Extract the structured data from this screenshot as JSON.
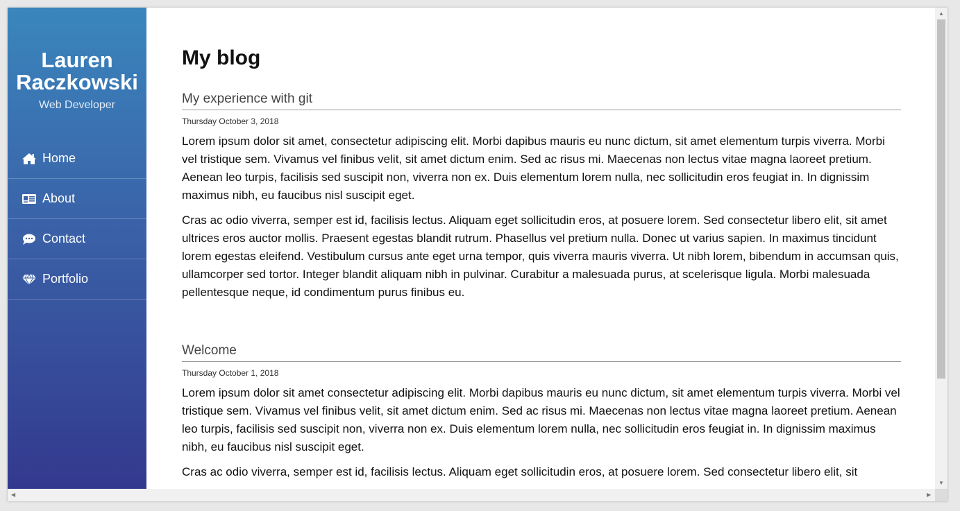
{
  "brand": {
    "name": "Lauren Raczkowski",
    "subtitle": "Web Developer"
  },
  "nav": [
    {
      "label": "Home",
      "icon": "home-icon"
    },
    {
      "label": "About",
      "icon": "id-card-icon"
    },
    {
      "label": "Contact",
      "icon": "chat-bubble-icon"
    },
    {
      "label": "Portfolio",
      "icon": "diamond-icon"
    }
  ],
  "page": {
    "title": "My blog"
  },
  "posts": [
    {
      "title": "My experience with git",
      "date": "Thursday October 3, 2018",
      "paragraphs": [
        "Lorem ipsum dolor sit amet, consectetur adipiscing elit. Morbi dapibus mauris eu nunc dictum, sit amet elementum turpis viverra. Morbi vel tristique sem. Vivamus vel finibus velit, sit amet dictum enim. Sed ac risus mi. Maecenas non lectus vitae magna laoreet pretium. Aenean leo turpis, facilisis sed suscipit non, viverra non ex. Duis elementum lorem nulla, nec sollicitudin eros feugiat in. In dignissim maximus nibh, eu faucibus nisl suscipit eget.",
        "Cras ac odio viverra, semper est id, facilisis lectus. Aliquam eget sollicitudin eros, at posuere lorem. Sed consectetur libero elit, sit amet ultrices eros auctor mollis. Praesent egestas blandit rutrum. Phasellus vel pretium nulla. Donec ut varius sapien. In maximus tincidunt lorem egestas eleifend. Vestibulum cursus ante eget urna tempor, quis viverra mauris viverra. Ut nibh lorem, bibendum in accumsan quis, ullamcorper sed tortor. Integer blandit aliquam nibh in pulvinar. Curabitur a malesuada purus, at scelerisque ligula. Morbi malesuada pellentesque neque, id condimentum purus finibus eu."
      ]
    },
    {
      "title": "Welcome",
      "date": "Thursday October 1, 2018",
      "paragraphs": [
        "Lorem ipsum dolor sit amet consectetur adipiscing elit. Morbi dapibus mauris eu nunc dictum, sit amet elementum turpis viverra. Morbi vel tristique sem. Vivamus vel finibus velit, sit amet dictum enim. Sed ac risus mi. Maecenas non lectus vitae magna laoreet pretium. Aenean leo turpis, facilisis sed suscipit non, viverra non ex. Duis elementum lorem nulla, nec sollicitudin eros feugiat in. In dignissim maximus nibh, eu faucibus nisl suscipit eget.",
        "Cras ac odio viverra, semper est id, facilisis lectus. Aliquam eget sollicitudin eros, at posuere lorem. Sed consectetur libero elit, sit"
      ]
    }
  ],
  "colors": {
    "sidebar_top": "#3a86bd",
    "sidebar_bottom": "#33398e"
  }
}
